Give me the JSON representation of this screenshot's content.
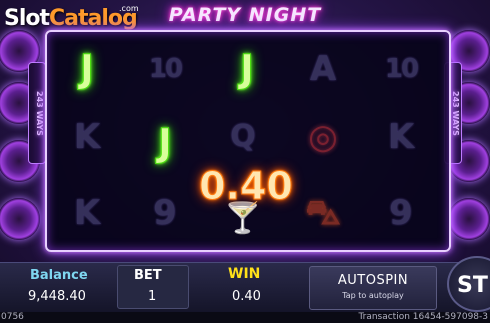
{
  "header": {
    "title": "PARTY NIGHT",
    "logo_slot": "Slot",
    "logo_catalog": "Catalog",
    "logo_com": ".com",
    "ways_label": "243 WAYS"
  },
  "reels": {
    "rows": [
      [
        "J",
        "10",
        "J",
        "A",
        "10"
      ],
      [
        "K",
        "J",
        "Q",
        "turntable",
        "K"
      ],
      [
        "K",
        "9",
        "cocktail",
        "car",
        "9"
      ]
    ],
    "win_amount": "0.40"
  },
  "bottom_bar": {
    "balance_label": "Balance",
    "balance_value": "9,448.40",
    "bet_label": "BET",
    "bet_value": "1",
    "win_label": "WIN",
    "win_value": "0.40",
    "autospin_label": "AUTOSPIN",
    "autospin_sub": "Tap to autoplay",
    "start_label": "ST"
  },
  "footer": {
    "left": "0756",
    "transaction": "Transaction 16454-597098-3"
  },
  "colors": {
    "reel_frame": "#e8d0ff",
    "neon_green": "#5cff20",
    "win_orange": "#ff6a00",
    "win_label_yellow": "#ffe01a",
    "balance_label_cyan": "#7fd6f0"
  }
}
